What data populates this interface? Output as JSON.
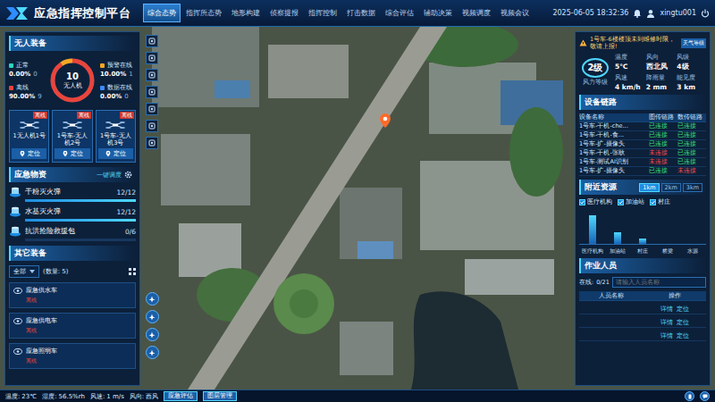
{
  "header": {
    "title": "应急指挥控制平台",
    "tabs": [
      {
        "label": "综合态势",
        "selected": true
      },
      {
        "label": "指挥所态势",
        "selected": false
      },
      {
        "label": "地形构建",
        "selected": false
      },
      {
        "label": "侦察提报",
        "selected": false
      },
      {
        "label": "指挥控制",
        "selected": false
      },
      {
        "label": "打击数据",
        "selected": false
      },
      {
        "label": "综合评估",
        "selected": false
      },
      {
        "label": "辅助决策",
        "selected": false
      },
      {
        "label": "视频调度",
        "selected": false
      },
      {
        "label": "视频会议",
        "selected": false
      }
    ],
    "datetime": "2025-06-05 18:32:36",
    "user": "xingtu001"
  },
  "drones": {
    "title": "无人装备",
    "ring": {
      "count": "10",
      "label": "无人机"
    },
    "stats": [
      {
        "label": "正常",
        "percent": "0.00%",
        "count": "0",
        "level": 0,
        "color": "#29d3c3"
      },
      {
        "label": "离线",
        "percent": "90.00%",
        "count": "9",
        "level": 0.9,
        "color": "#e8453c"
      },
      {
        "label": "预警在线",
        "percent": "10.00%",
        "count": "1",
        "level": 0.1,
        "color": "#f5a623"
      },
      {
        "label": "数据在线",
        "percent": "0.00%",
        "count": "0",
        "level": 0,
        "color": "#3b8cff"
      }
    ],
    "cards": [
      {
        "name": "1无人机1号",
        "status": "离线",
        "button": "定位"
      },
      {
        "name": "1号车-无人机2号",
        "status": "离线",
        "button": "定位"
      },
      {
        "name": "1号车-无人机3号",
        "status": "离线",
        "button": "定位"
      }
    ]
  },
  "supplies": {
    "title": "应急物资",
    "action": "一键调度",
    "items": [
      {
        "name": "干粉灭火弹",
        "count": "12/12",
        "level": 1
      },
      {
        "name": "水基灭火弹",
        "count": "12/12",
        "level": 1
      },
      {
        "name": "抗洪抢险救援包",
        "count": "0/6",
        "level": 0
      }
    ]
  },
  "equipment": {
    "title": "其它装备",
    "filter": "全部",
    "total": "(数量: 5)",
    "items": [
      {
        "name": "应急供水车",
        "status": "离线"
      },
      {
        "name": "应急供电车",
        "status": "离线"
      },
      {
        "name": "应急照明车",
        "status": "离线"
      }
    ]
  },
  "alert": {
    "text": "1号车-6楼楼顶未到维修时限，敬请上报!",
    "badge": "天气等级"
  },
  "weather": {
    "level": {
      "value": "2级",
      "label": "风力等级"
    },
    "metrics": [
      {
        "label": "温度",
        "value": "5℃"
      },
      {
        "label": "风向",
        "value": "西北风"
      },
      {
        "label": "风级",
        "value": "4级"
      },
      {
        "label": "风速",
        "value": "4 km/h"
      },
      {
        "label": "降雨量",
        "value": "2 mm"
      },
      {
        "label": "能见度",
        "value": "3 km"
      }
    ]
  },
  "links": {
    "title": "设备链路",
    "columns": [
      "设备名称",
      "图传链路",
      "数传链路"
    ],
    "rows": [
      {
        "name": "1号车-干机-che...",
        "video": {
          "text": "已连接",
          "ok": true
        },
        "data": {
          "text": "已连接",
          "ok": true
        }
      },
      {
        "name": "1号车-干机-食...",
        "video": {
          "text": "已连接",
          "ok": true
        },
        "data": {
          "text": "已连接",
          "ok": true
        }
      },
      {
        "name": "1号车-扩-摄像头",
        "video": {
          "text": "已连接",
          "ok": true
        },
        "data": {
          "text": "已连接",
          "ok": true
        }
      },
      {
        "name": "1号车-干机-张耿",
        "video": {
          "text": "未连接",
          "ok": false
        },
        "data": {
          "text": "已连接",
          "ok": true
        }
      },
      {
        "name": "1号车-测试AI识别",
        "video": {
          "text": "未连接",
          "ok": false
        },
        "data": {
          "text": "已连接",
          "ok": true
        }
      },
      {
        "name": "1号车-扩-摄像头",
        "video": {
          "text": "已连接",
          "ok": true
        },
        "data": {
          "text": "未连接",
          "ok": false
        }
      }
    ]
  },
  "nearby": {
    "title": "附近资源",
    "ranges": [
      {
        "label": "1km",
        "selected": true
      },
      {
        "label": "2km",
        "selected": false
      },
      {
        "label": "3km",
        "selected": false
      }
    ],
    "filters": [
      {
        "label": "医疗机构",
        "checked": true
      },
      {
        "label": "加油站",
        "checked": true
      },
      {
        "label": "村庄",
        "checked": true
      }
    ],
    "chart": {
      "categories": [
        "医疗机构",
        "加油站",
        "村庄",
        "桥梁",
        "水源"
      ],
      "values": [
        5,
        2,
        1,
        0,
        0
      ]
    }
  },
  "staff": {
    "title": "作业人员",
    "online_label": "在线:",
    "online": "0/21",
    "search_placeholder": "请输入人员名称",
    "columns": [
      "人员名称",
      "操作"
    ],
    "rows": [
      {
        "actions": [
          "详情",
          "定位"
        ]
      },
      {
        "actions": [
          "详情",
          "定位"
        ]
      },
      {
        "actions": [
          "详情",
          "定位"
        ]
      }
    ]
  },
  "status_bar": {
    "items": [
      {
        "label": "温度:",
        "value": "23℃"
      },
      {
        "label": "湿度:",
        "value": "56.5%rh"
      },
      {
        "label": "风速:",
        "value": "1 m/s"
      },
      {
        "label": "风向:",
        "value": "西风"
      }
    ],
    "buttons": [
      "应急评估",
      "图层管理"
    ]
  }
}
